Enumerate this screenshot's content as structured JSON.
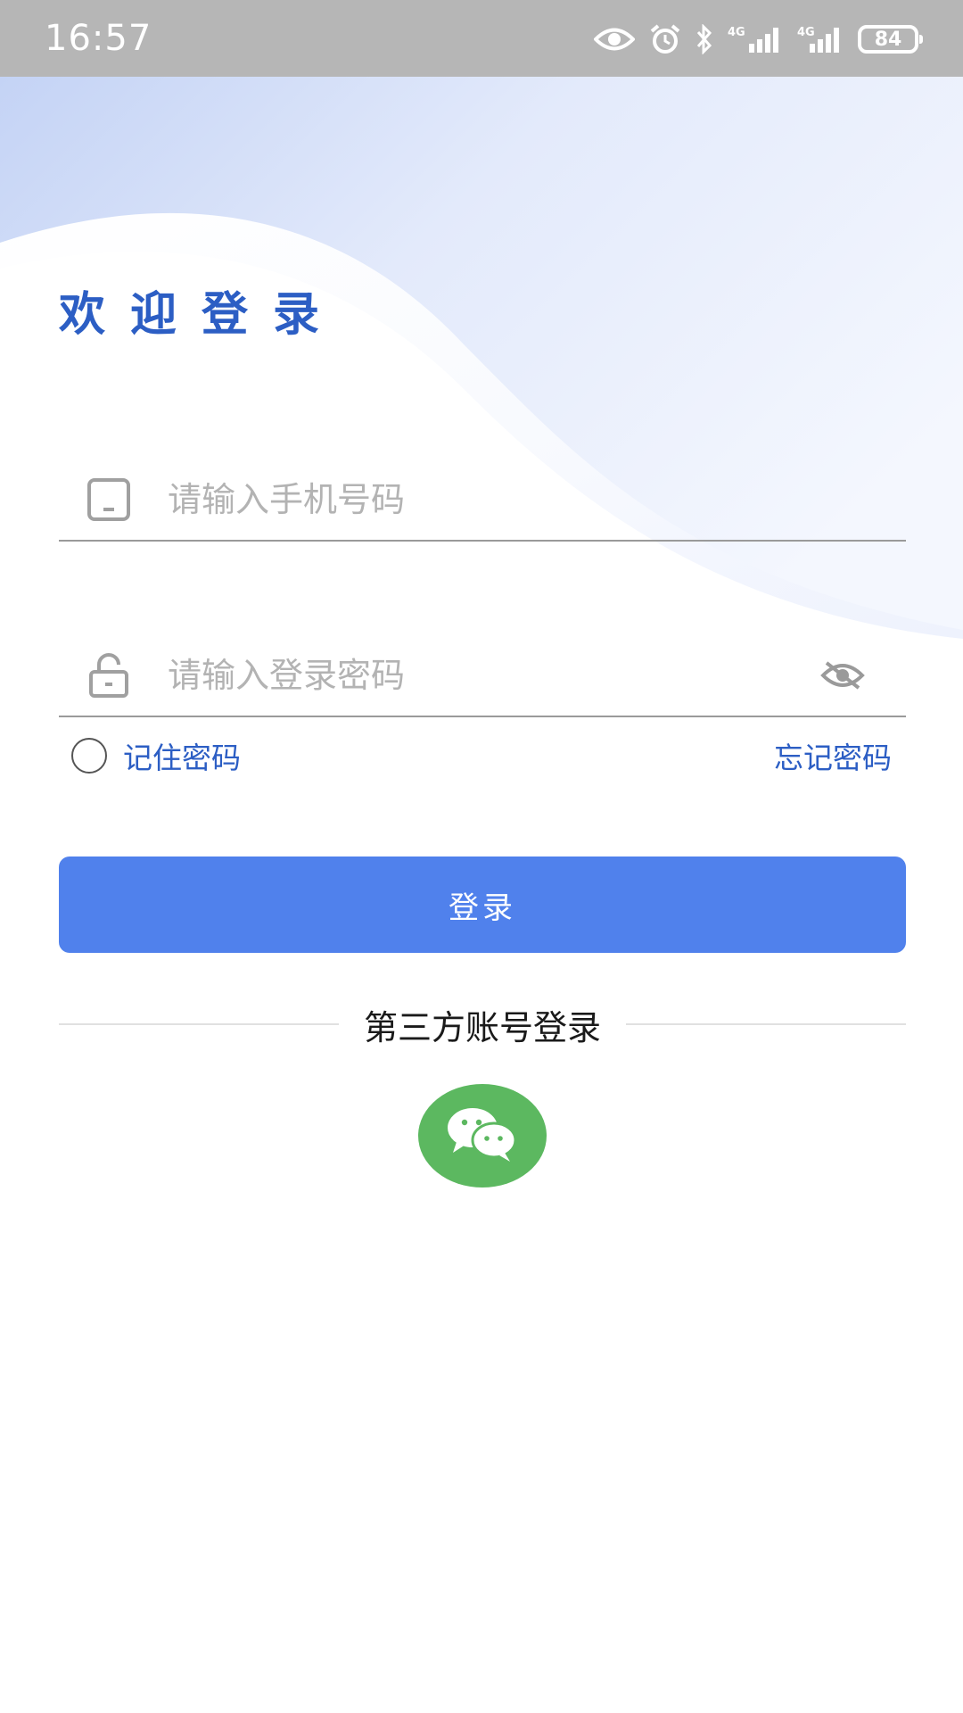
{
  "status_bar": {
    "time": "16:57",
    "icons": [
      "eye-icon",
      "alarm-icon",
      "bluetooth-icon",
      "signal-4g-icon",
      "signal-4g-icon"
    ],
    "battery": "84"
  },
  "header": {
    "title": "欢迎登录"
  },
  "form": {
    "phone_placeholder": "请输入手机号码",
    "password_placeholder": "请输入登录密码",
    "remember_label": "记住密码",
    "forgot_label": "忘记密码",
    "login_label": "登录"
  },
  "third_party": {
    "label": "第三方账号登录",
    "providers": [
      "wechat-icon"
    ]
  },
  "colors": {
    "accent": "#2c5ec4",
    "button": "#5081ec",
    "wechat": "#5cb860",
    "status_bar": "#b6b6b6"
  }
}
